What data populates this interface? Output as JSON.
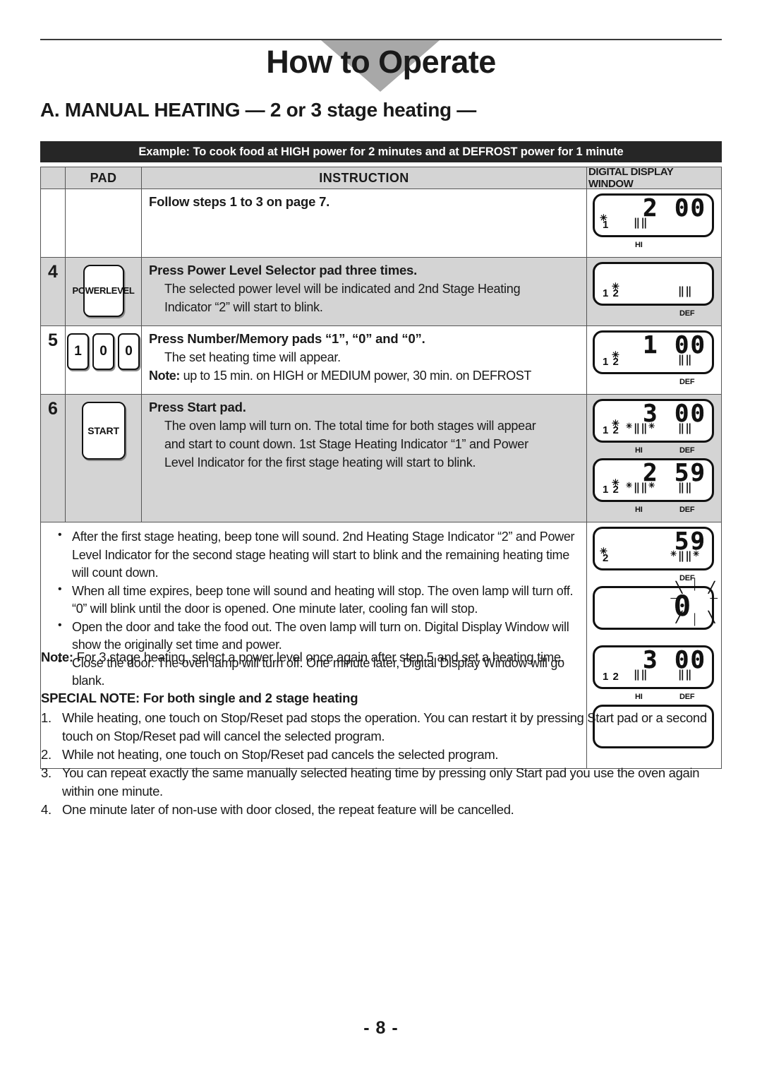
{
  "header": {
    "title": "How to Operate",
    "section_title": "A. MANUAL HEATING — 2 or 3 stage heating —",
    "example_bar": "Example: To cook food at HIGH power for 2 minutes and at DEFROST power for 1 minute"
  },
  "table": {
    "columns": {
      "step": "",
      "pad": "PAD",
      "instruction": "INSTRUCTION",
      "display": "DIGITAL DISPLAY WINDOW"
    },
    "rows": [
      {
        "step": "",
        "shade": "white",
        "pad": null,
        "instruction": {
          "title": "Follow steps 1 to 3 on page 7.",
          "body": [],
          "note": null
        },
        "displays": [
          {
            "digits": "2 00",
            "stage": "1",
            "stage_blink": true,
            "bars": [
              "hi"
            ],
            "bar_blink": [],
            "labels": [
              "HI"
            ]
          }
        ]
      },
      {
        "step": "4",
        "shade": "gray",
        "pad": {
          "type": "power-level",
          "lines": [
            "POWER",
            "LEVEL"
          ]
        },
        "instruction": {
          "title": "Press Power Level Selector pad three times.",
          "body": [
            "The selected power level will be indicated and 2nd Stage Heating",
            "Indicator “2” will start to blink."
          ],
          "note": null
        },
        "displays": [
          {
            "digits": "",
            "stage": "1 2",
            "stage_blink": true,
            "bars": [
              "def"
            ],
            "bar_blink": [],
            "labels": [
              "DEF"
            ]
          }
        ]
      },
      {
        "step": "5",
        "shade": "white",
        "pad": {
          "type": "number-pads",
          "keys": [
            "1",
            "0",
            "0"
          ]
        },
        "instruction": {
          "title": "Press Number/Memory pads “1”, “0” and “0”.",
          "body": [
            "The set heating time will appear."
          ],
          "note_label": "Note:",
          "note": " up to 15 min. on HIGH or MEDIUM power, 30 min. on DEFROST"
        },
        "displays": [
          {
            "digits": "1 00",
            "stage": "1 2",
            "stage_blink": true,
            "bars": [
              "def"
            ],
            "bar_blink": [],
            "labels": [
              "DEF"
            ]
          }
        ]
      },
      {
        "step": "6",
        "shade": "gray",
        "pad": {
          "type": "start",
          "lines": [
            "START"
          ]
        },
        "instruction": {
          "title": "Press Start pad.",
          "body": [
            "The oven lamp will turn on. The total time for both stages will appear",
            "and start to count down. 1st Stage Heating Indicator “1” and Power",
            "Level Indicator for the first stage heating will start to blink."
          ],
          "note": null
        },
        "displays": [
          {
            "digits": "3 00",
            "stage": "1 2",
            "stage_blink": true,
            "bars": [
              "hi",
              "def"
            ],
            "bar_blink": [
              "hi"
            ],
            "labels": [
              "HI",
              "DEF"
            ]
          },
          {
            "digits": "2 59",
            "stage": "1 2",
            "stage_blink": true,
            "bars": [
              "hi",
              "def"
            ],
            "bar_blink": [
              "hi"
            ],
            "labels": [
              "HI",
              "DEF"
            ]
          }
        ]
      }
    ],
    "bullets_row": {
      "shade": "white",
      "bullets": [
        "After the first stage heating, beep tone will sound. 2nd Heating Stage Indicator “2” and Power Level Indicator for the second stage heating will start to blink and the remaining heating time will count down.",
        "When all time expires, beep tone will sound and heating will stop. The oven lamp will turn off. “0” will blink until the door is opened. One minute later, cooling fan will stop.",
        "Open the door and take the food out. The oven lamp will turn on. Digital Display Window will show the originally set time and power.",
        "Close the door. The oven lamp will turn off. One minute later, Digital Display Window will go blank."
      ],
      "displays": [
        {
          "digits": "59",
          "stage": "2",
          "stage_blink": true,
          "bars": [
            "def"
          ],
          "bar_blink": [
            "def"
          ],
          "labels": [
            "DEF"
          ]
        },
        {
          "digits": "0",
          "stage": "",
          "stage_blink": false,
          "bars": [],
          "bar_blink": [],
          "labels": [],
          "digit_blink": true
        },
        {
          "digits": "3 00",
          "stage": "1 2",
          "stage_blink": false,
          "bars": [
            "hi",
            "def"
          ],
          "bar_blink": [],
          "labels": [
            "HI",
            "DEF"
          ]
        },
        {
          "digits": "",
          "stage": "",
          "stage_blink": false,
          "bars": [],
          "bar_blink": [],
          "labels": []
        }
      ]
    }
  },
  "footer": {
    "note_label": "Note:",
    "note_text": " For 3 stage heating, select a power level once again after step 5 and set a heating time.",
    "special_note_heading": "SPECIAL NOTE: For both single and 2 stage heating",
    "special_items": [
      {
        "n": "1.",
        "text": "While heating, one touch on Stop/Reset pad stops the operation. You can restart it by pressing Start pad or a second touch on Stop/Reset pad will cancel the selected program."
      },
      {
        "n": "2.",
        "text": "While not heating, one touch on Stop/Reset pad cancels the selected program."
      },
      {
        "n": "3.",
        "text": "You can repeat exactly the same manually selected heating time by pressing only Start pad you use the oven again within one minute."
      },
      {
        "n": "4.",
        "text": "One minute later of non-use with door closed, the repeat feature will be cancelled."
      }
    ],
    "page_number": "- 8 -"
  },
  "colors": {
    "row_shade": "#d4d4d4",
    "example_bar_bg": "#262626",
    "triangle": "#a8a8a8",
    "border": "#555555"
  }
}
